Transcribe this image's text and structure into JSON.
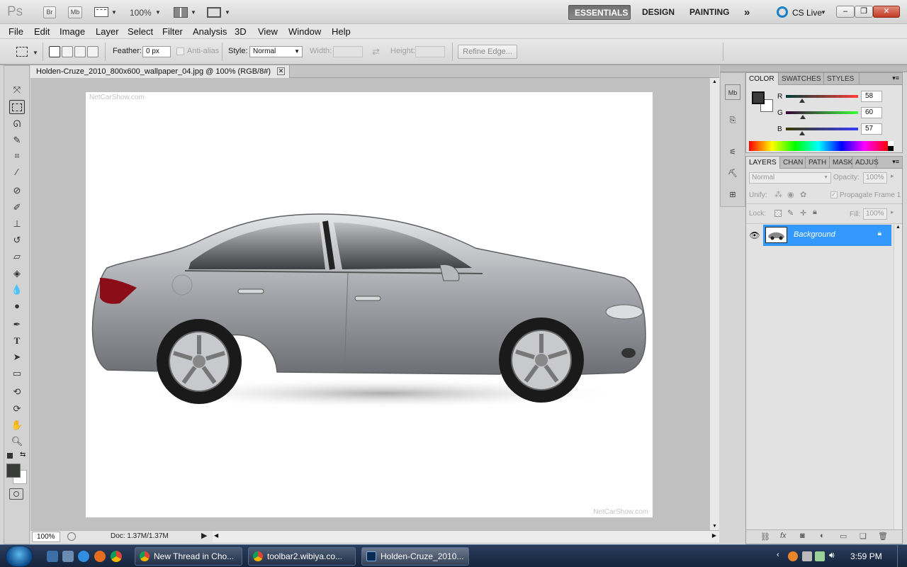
{
  "app": {
    "logo": "Ps"
  },
  "top_toolbar": {
    "bridge": "Br",
    "minibridge": "Mb",
    "zoom": "100%",
    "workspaces": [
      "ESSENTIALS",
      "DESIGN",
      "PAINTING"
    ],
    "workspace_more": "»",
    "cs_live": "CS Live"
  },
  "menubar": [
    "File",
    "Edit",
    "Image",
    "Layer",
    "Select",
    "Filter",
    "Analysis",
    "3D",
    "View",
    "Window",
    "Help"
  ],
  "options": {
    "feather_label": "Feather:",
    "feather_value": "0 px",
    "antialias_label": "Anti-alias",
    "style_label": "Style:",
    "style_value": "Normal",
    "width_label": "Width:",
    "height_label": "Height:",
    "refine_edge": "Refine Edge..."
  },
  "document": {
    "tab_title": "Holden-Cruze_2010_800x600_wallpaper_04.jpg @ 100% (RGB/8#)",
    "watermark_top": "NetCarShow.com",
    "watermark_bottom": "NetCarShow.com",
    "zoom": "100%",
    "doc_info": "Doc: 1.37M/1.37M"
  },
  "color_panel": {
    "tabs": [
      "COLOR",
      "SWATCHES",
      "STYLES"
    ],
    "foreground": "#3a3c39",
    "background": "#ffffff",
    "channels": [
      {
        "label": "R",
        "value": "58",
        "level": 0.227
      },
      {
        "label": "G",
        "value": "60",
        "level": 0.235
      },
      {
        "label": "B",
        "value": "57",
        "level": 0.224
      }
    ]
  },
  "layers_panel": {
    "tabs": [
      "LAYERS",
      "CHAN",
      "PATH",
      "MASK",
      "ADJUS"
    ],
    "blend_mode": "Normal",
    "opacity_label": "Opacity:",
    "opacity_value": "100%",
    "unify_label": "Unify:",
    "propagate_label": "Propagate Frame 1",
    "lock_label": "Lock:",
    "fill_label": "Fill:",
    "fill_value": "100%",
    "layers": [
      {
        "name": "Background",
        "selected": true
      }
    ]
  },
  "taskbar": {
    "tasks": [
      "New Thread in Cho...",
      "toolbar2.wibiya.co...",
      "Holden-Cruze_2010..."
    ],
    "clock": "3:59 PM"
  }
}
